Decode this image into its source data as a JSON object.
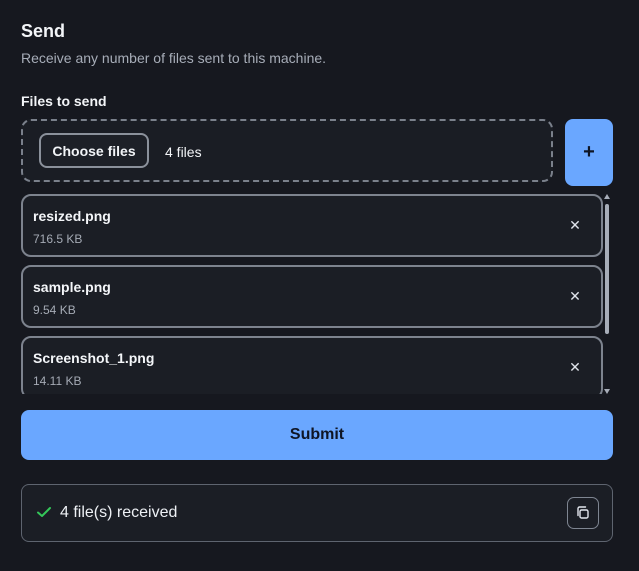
{
  "header": {
    "title": "Send",
    "subtitle": "Receive any number of files sent to this machine."
  },
  "upload": {
    "label": "Files to send",
    "choose_files_label": "Choose files",
    "file_count_text": "4 files",
    "add_label": "+"
  },
  "files": [
    {
      "name": "resized.png",
      "size": "716.5 KB"
    },
    {
      "name": "sample.png",
      "size": "9.54 KB"
    },
    {
      "name": "Screenshot_1.png",
      "size": "14.11 KB"
    }
  ],
  "actions": {
    "submit_label": "Submit"
  },
  "status": {
    "text": "4 file(s) received"
  },
  "colors": {
    "background": "#16181f",
    "accent": "#6aa7ff",
    "success": "#34c759"
  },
  "icons": {
    "remove": "close-icon",
    "status": "check-icon",
    "copy": "copy-icon"
  }
}
